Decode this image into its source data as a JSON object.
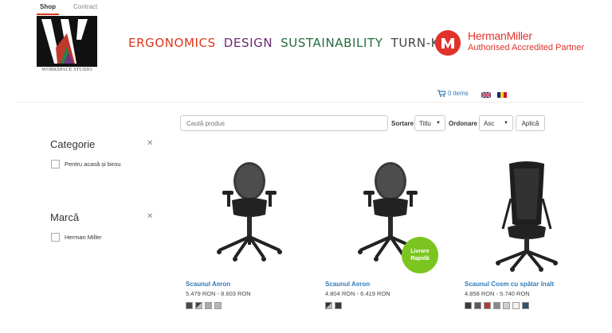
{
  "topnav": {
    "shop": "Shop",
    "contract": "Contract"
  },
  "logo": {
    "caption": "WORKSPACE STUDIO"
  },
  "tagline": {
    "ergonomics": "ERGONOMICS",
    "design": "DESIGN",
    "sustainability": "SUSTAINABILITY",
    "turnkey": "TURN-KEY"
  },
  "partner": {
    "name": "HermanMiller",
    "subtitle": "Authorised Accredited Partner"
  },
  "cart": {
    "label": "0 items",
    "icon": "cart-icon"
  },
  "languages": [
    "en",
    "ro"
  ],
  "toolbar": {
    "search_placeholder": "Caută produs",
    "sort_label": "Sortare",
    "sort_value": "Titlu",
    "order_label": "Ordonare",
    "order_value": "Asc",
    "apply_label": "Aplică"
  },
  "filters": [
    {
      "title": "Categorie",
      "option": "Pentru acasă și birou"
    },
    {
      "title": "Marcă",
      "option": "Herman Miller"
    }
  ],
  "products": [
    {
      "name": "Scaunul Aeron",
      "price": "5.479 RON - 8.603 RON",
      "swatches": [
        "#4a4a4a",
        "#888888",
        "#aaaaaa",
        "#b5b5b5"
      ],
      "badge": ""
    },
    {
      "name": "Scaunul Aeron",
      "price": "4.804 RON - 6.419 RON",
      "swatches": [
        "#3a3a3a",
        "#555555"
      ],
      "badge": "Livrare Rapidă"
    },
    {
      "name": "Scaunul Cosm cu spătar înalt",
      "price": "4.858 RON - 5.740 RON",
      "swatches": [
        "#3a3a3a",
        "#5a5a5a",
        "#b03a3a",
        "#8a8a8a",
        "#cfcfcf",
        "#f2f2f2",
        "#34506b"
      ],
      "badge": ""
    }
  ]
}
